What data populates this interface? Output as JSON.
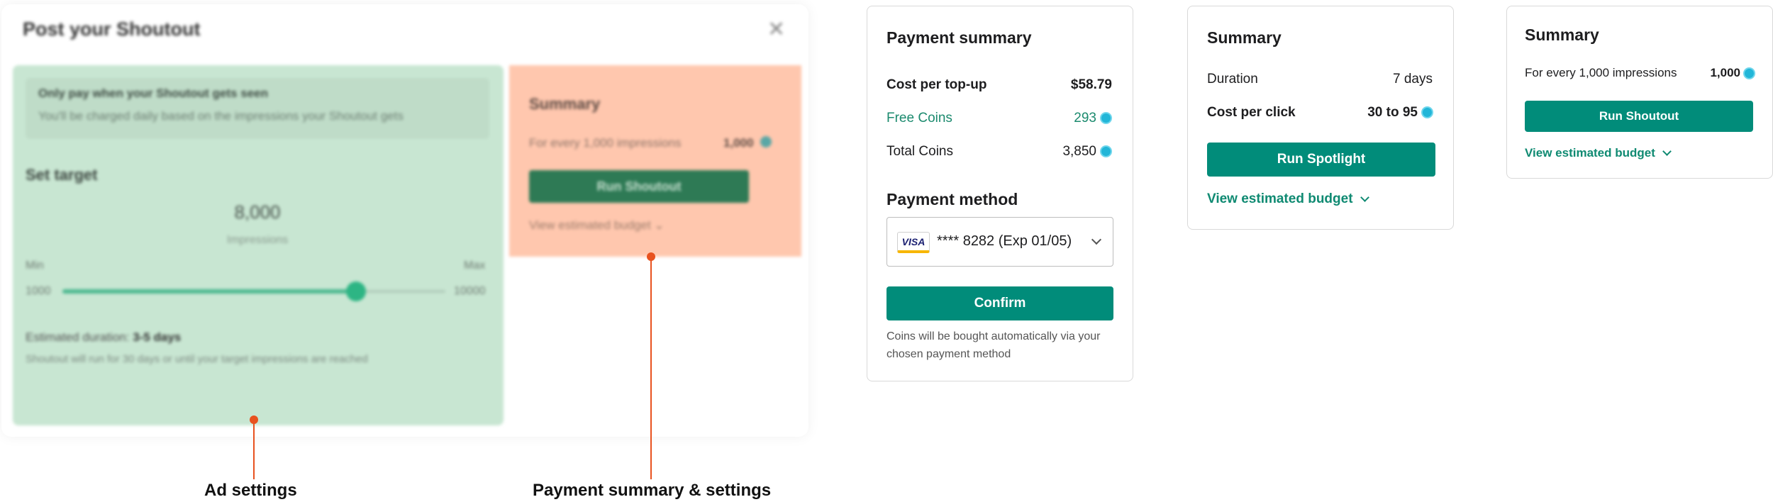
{
  "modal": {
    "title": "Post your Shoutout",
    "close_icon": "close-icon",
    "notice_title": "Only pay when your Shoutout gets seen",
    "notice_subtitle": "You'll be charged daily based on the impressions your Shoutout gets",
    "set_target_label": "Set target",
    "target_value": "8,000",
    "target_unit": "Impressions",
    "slider_min_label": "Min",
    "slider_max_label": "Max",
    "slider_min_value": "1000",
    "slider_max_value": "10000",
    "slider_level": 0.77,
    "estimated_duration_label": "Estimated duration:",
    "estimated_duration_value": "3-5 days",
    "duration_note": "Shoutout will run for 30 days or until your target impressions are reached",
    "summary_title": "Summary",
    "summary_row_label": "For every 1,000 impressions",
    "summary_row_value": "1,000",
    "run_button": "Run Shoutout",
    "budget_link": "View estimated budget"
  },
  "callouts": {
    "ad_settings": "Ad settings",
    "payment_summary": "Payment summary & settings",
    "accent_color": "#e8521f"
  },
  "payment_card": {
    "title": "Payment summary",
    "rows": [
      {
        "label": "Cost per top-up",
        "value": "$58.79"
      },
      {
        "label": "Free Coins",
        "value": "293"
      },
      {
        "label": "Total Coins",
        "value": "3,850"
      }
    ],
    "method_title": "Payment method",
    "card_brand": "VISA",
    "card_text": "**** 8282 (Exp 01/05)",
    "confirm_button": "Confirm",
    "note": "Coins will be bought automatically via your chosen payment method"
  },
  "spotlight_card": {
    "title": "Summary",
    "rows": [
      {
        "label": "Duration",
        "value": "7 days"
      },
      {
        "label": "Cost per click",
        "value": "30 to 95"
      }
    ],
    "run_button": "Run Spotlight",
    "budget_link": "View estimated budget"
  },
  "shoutout_card": {
    "title": "Summary",
    "row_label": "For every 1,000 impressions",
    "row_value": "1,000",
    "run_button": "Run Shoutout",
    "budget_link": "View estimated budget"
  },
  "colors": {
    "primary": "#018c7a",
    "ad_zone": "#c8e6d2",
    "payment_zone": "#ffc7ae",
    "coin": "#22b6d8"
  }
}
